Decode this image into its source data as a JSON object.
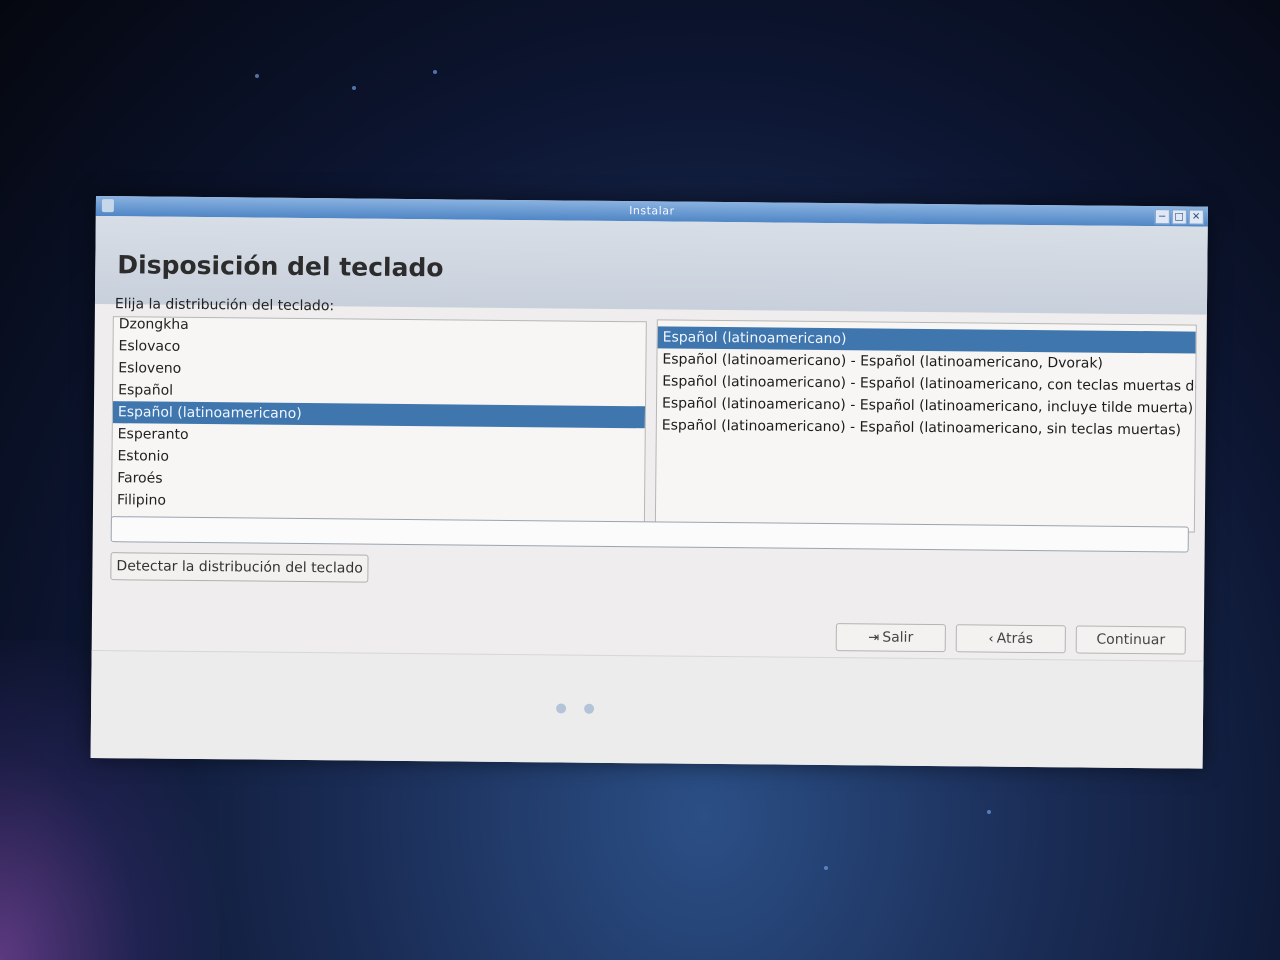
{
  "window": {
    "title": "Instalar",
    "buttons": {
      "minimize": "−",
      "maximize": "□",
      "close": "✕"
    }
  },
  "page": {
    "title": "Disposición del teclado",
    "prompt": "Elija la distribución del teclado:"
  },
  "layouts": {
    "items": [
      "Dzongkha",
      "Eslovaco",
      "Esloveno",
      "Español",
      "Español (latinoamericano)",
      "Esperanto",
      "Estonio",
      "Faroés",
      "Filipino"
    ],
    "selected": "Español (latinoamericano)"
  },
  "variants": {
    "items": [
      "Español (latinoamericano)",
      "Español (latinoamericano) - Español (latinoamericano, Dvorak)",
      "Español (latinoamericano) - Español (latinoamericano, con teclas muertas de Sun)",
      "Español (latinoamericano) - Español (latinoamericano, incluye tilde muerta)",
      "Español (latinoamericano) - Español (latinoamericano, sin teclas muertas)"
    ],
    "selected": "Español (latinoamericano)"
  },
  "test_input": {
    "value": ""
  },
  "actions": {
    "detect": "Detectar la distribución del teclado",
    "quit": "Salir",
    "back": "Atrás",
    "continue": "Continuar"
  },
  "icons": {
    "quit": "exit-icon",
    "back": "chevron-left-icon"
  },
  "colors": {
    "selection": "#3f76ae",
    "titlebar": "#4f86c6"
  }
}
